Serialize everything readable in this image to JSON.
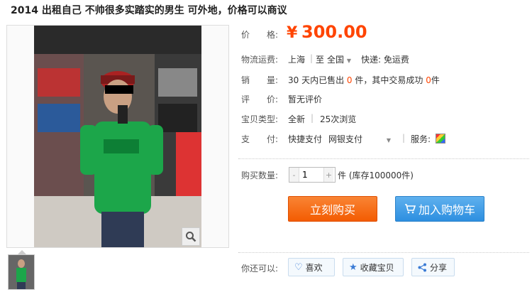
{
  "product": {
    "title": "2014 出租自己 不帅很多实踏实的男生 可外地，价格可以商议"
  },
  "price": {
    "label": "价　　格:",
    "currency": "¥",
    "amount": "300.00"
  },
  "shipping": {
    "label": "物流运费:",
    "from": "上海",
    "separator": "|",
    "to_label": "至",
    "to": "全国",
    "express": "快递: 免运费"
  },
  "sales": {
    "label": "销　　量:",
    "prefix": "30 天内已售出",
    "sold": "0",
    "mid": "件，其中交易成功",
    "success": "0",
    "suffix": "件"
  },
  "rating": {
    "label": "评　　价:",
    "value": "暂无评价"
  },
  "item_type": {
    "label": "宝贝类型:",
    "condition": "全新",
    "separator": "|",
    "views": "25次浏览"
  },
  "payment": {
    "label": "支　　付:",
    "method1": "快捷支付",
    "method2": "网银支付",
    "separator": "|",
    "service_label": "服务:"
  },
  "quantity": {
    "label": "购买数量:",
    "value": "1",
    "minus": "-",
    "plus": "+",
    "unit": "件 (库存100000件)"
  },
  "actions": {
    "buy_now": "立刻购买",
    "add_cart": "加入购物车"
  },
  "extras": {
    "label": "你还可以:",
    "like": "喜欢",
    "favorite": "收藏宝贝",
    "share": "分享"
  },
  "colors": {
    "price": "#ff4400",
    "buy_button": "#f35c02",
    "cart_button": "#2d8fe0"
  }
}
